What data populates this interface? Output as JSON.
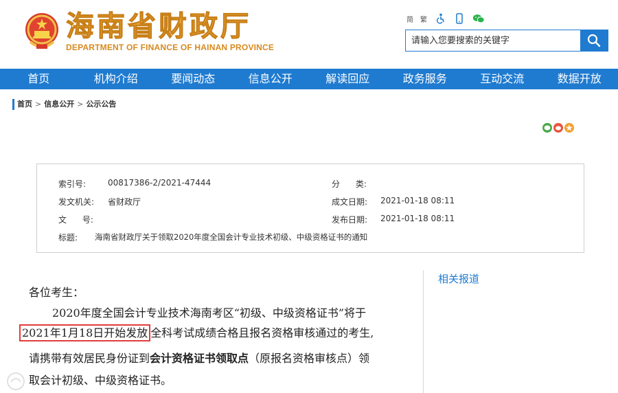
{
  "header": {
    "title_cn": "海南省财政厅",
    "title_en": "DEPARTMENT OF FINANCE OF HAINAN PROVINCE",
    "tools": {
      "simplified": "简",
      "traditional": "繁"
    },
    "search": {
      "placeholder": "请输入您要搜索的关键字"
    }
  },
  "nav": {
    "items": [
      "首页",
      "机构介绍",
      "要闻动态",
      "信息公开",
      "解读回应",
      "政务服务",
      "互动交流",
      "数据开放"
    ]
  },
  "breadcrumb": {
    "items": [
      "首页",
      "信息公开",
      "公示公告"
    ],
    "separator": ">"
  },
  "info": {
    "index_label": "索引号:",
    "index_value": "00817386-2/2021-47444",
    "category_label": "分      类:",
    "category_value": "",
    "issuer_label": "发文机关:",
    "issuer_value": "省财政厅",
    "created_label": "成文日期:",
    "created_value": "2021-01-18 08:11",
    "docno_label": "文      号:",
    "docno_value": "",
    "published_label": "发布日期:",
    "published_value": "2021-01-18 08:11",
    "title_label": "标题:",
    "title_value": "海南省财政厅关于领取2020年度全国会计专业技术初级、中级资格证书的通知"
  },
  "article": {
    "greeting": "各位考生：",
    "line1": "2020年度全国会计专业技术海南考区“初级、中级资格证书”将于",
    "line2_highlight": "2021年1月18日开始发放",
    "line2_rest": "全科考试成绩合格且报名资格审核通过的考生,",
    "line3_a": "请携带有效居民身份证到",
    "line3_bold": "会计资格证书领取点",
    "line3_b": "（原报名资格审核点）领",
    "line4": "取会计初级、中级资格证书。"
  },
  "sidebar": {
    "related_label": "相关报道"
  },
  "colors": {
    "brand_blue": "#1f7bd0",
    "title_gold": "#e8a43a",
    "highlight_red": "#e23b3b"
  }
}
